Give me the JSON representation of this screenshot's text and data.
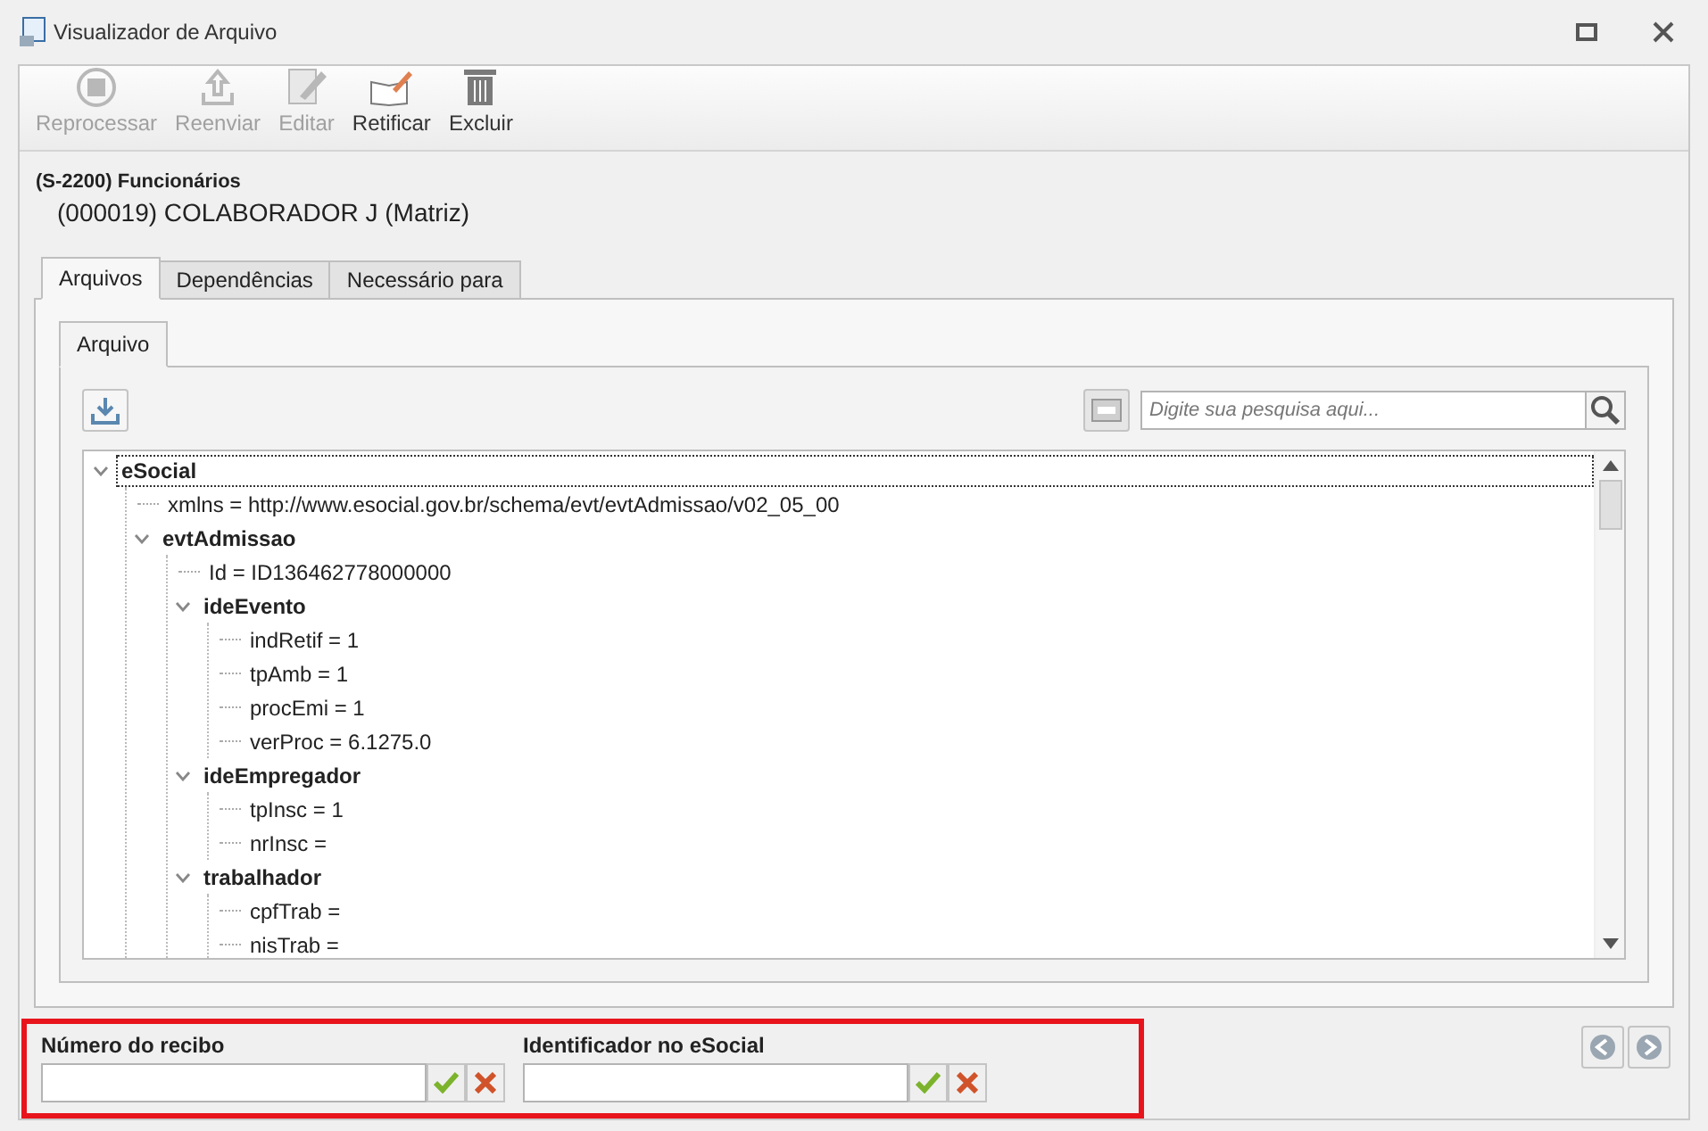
{
  "window": {
    "title": "Visualizador de Arquivo"
  },
  "toolbar": [
    {
      "label": "Reprocessar",
      "disabled": true,
      "kind": "reprocess"
    },
    {
      "label": "Reenviar",
      "disabled": true,
      "kind": "upload"
    },
    {
      "label": "Editar",
      "disabled": true,
      "kind": "edit"
    },
    {
      "label": "Retificar",
      "disabled": false,
      "kind": "rectify"
    },
    {
      "label": "Excluir",
      "disabled": false,
      "kind": "delete"
    }
  ],
  "header": {
    "event": "(S-2200) Funcionários",
    "employee": "(000019) COLABORADOR J (Matriz)"
  },
  "tabs": [
    {
      "label": "Arquivos",
      "selected": true
    },
    {
      "label": "Dependências",
      "selected": false
    },
    {
      "label": "Necessário para",
      "selected": false
    }
  ],
  "inner_tabs": [
    {
      "label": "Arquivo",
      "selected": true
    }
  ],
  "search": {
    "placeholder": "Digite sua pesquisa aqui..."
  },
  "tree": [
    {
      "label": "eSocial",
      "selected": true,
      "expanded": true,
      "children": [
        {
          "label": "xmlns = http://www.esocial.gov.br/schema/evt/evtAdmissao/v02_05_00",
          "selected": false
        },
        {
          "label": "evtAdmissao",
          "selected": false,
          "expanded": true,
          "children": [
            {
              "label": "Id = ID136462778000000",
              "selected": false
            },
            {
              "label": "ideEvento",
              "selected": false,
              "expanded": true,
              "children": [
                {
                  "label": "indRetif = 1",
                  "selected": false
                },
                {
                  "label": "tpAmb = 1",
                  "selected": false
                },
                {
                  "label": "procEmi = 1",
                  "selected": false
                },
                {
                  "label": "verProc = 6.1275.0",
                  "selected": false
                }
              ]
            },
            {
              "label": "ideEmpregador",
              "selected": false,
              "expanded": true,
              "children": [
                {
                  "label": "tpInsc = 1",
                  "selected": false
                },
                {
                  "label": "nrInsc =",
                  "selected": false
                }
              ]
            },
            {
              "label": "trabalhador",
              "selected": false,
              "expanded": true,
              "children": [
                {
                  "label": "cpfTrab =",
                  "selected": false
                },
                {
                  "label": "nisTrab =",
                  "selected": false
                }
              ]
            }
          ]
        }
      ]
    }
  ],
  "fields": [
    {
      "label": "Número do recibo"
    },
    {
      "label": "Identificador no eSocial"
    }
  ]
}
